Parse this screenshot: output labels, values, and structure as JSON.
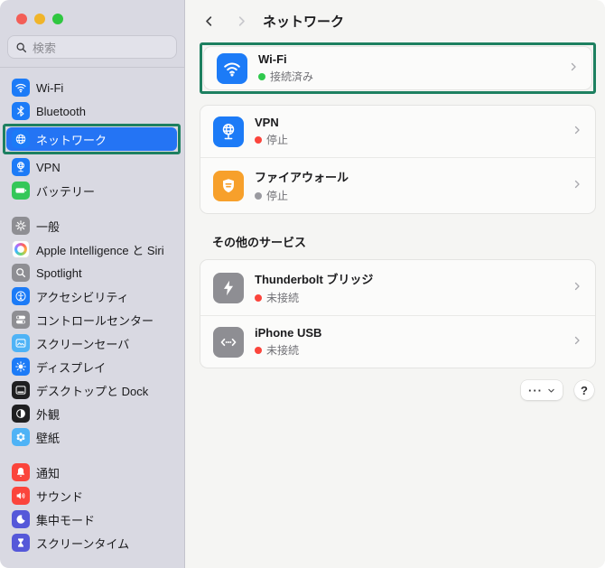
{
  "colors": {
    "annotation_green": "#1d8060",
    "sidebar_selected_blue": "#2474f4",
    "status_connected_green": "#2fc94d",
    "status_error_red": "#fb453c",
    "status_off_gray": "#9a9aa0",
    "app_icon_blue": "#1c7bf7",
    "firewall_orange": "#f7a02b"
  },
  "sidebar": {
    "search_placeholder": "検索",
    "items": [
      {
        "label": "Wi-Fi"
      },
      {
        "label": "Bluetooth"
      },
      {
        "label": "ネットワーク",
        "selected": true
      },
      {
        "label": "VPN"
      },
      {
        "label": "バッテリー"
      },
      {
        "label": "一般"
      },
      {
        "label": "Apple Intelligence と Siri"
      },
      {
        "label": "Spotlight"
      },
      {
        "label": "アクセシビリティ"
      },
      {
        "label": "コントロールセンター"
      },
      {
        "label": "スクリーンセーバ"
      },
      {
        "label": "ディスプレイ"
      },
      {
        "label": "デスクトップと Dock"
      },
      {
        "label": "外観"
      },
      {
        "label": "壁紙"
      },
      {
        "label": "通知"
      },
      {
        "label": "サウンド"
      },
      {
        "label": "集中モード"
      },
      {
        "label": "スクリーンタイム"
      }
    ]
  },
  "header": {
    "title": "ネットワーク"
  },
  "main": {
    "rows": {
      "wifi": {
        "label": "Wi-Fi",
        "status": "接続済み"
      },
      "vpn": {
        "label": "VPN",
        "status": "停止"
      },
      "firewall": {
        "label": "ファイアウォール",
        "status": "停止"
      },
      "thunderbolt": {
        "label": "Thunderbolt ブリッジ",
        "status": "未接続"
      },
      "iphone_usb": {
        "label": "iPhone USB",
        "status": "未接続"
      }
    },
    "section_other_services": "その他のサービス",
    "footer": {
      "more_label": "···",
      "help_label": "?"
    }
  }
}
